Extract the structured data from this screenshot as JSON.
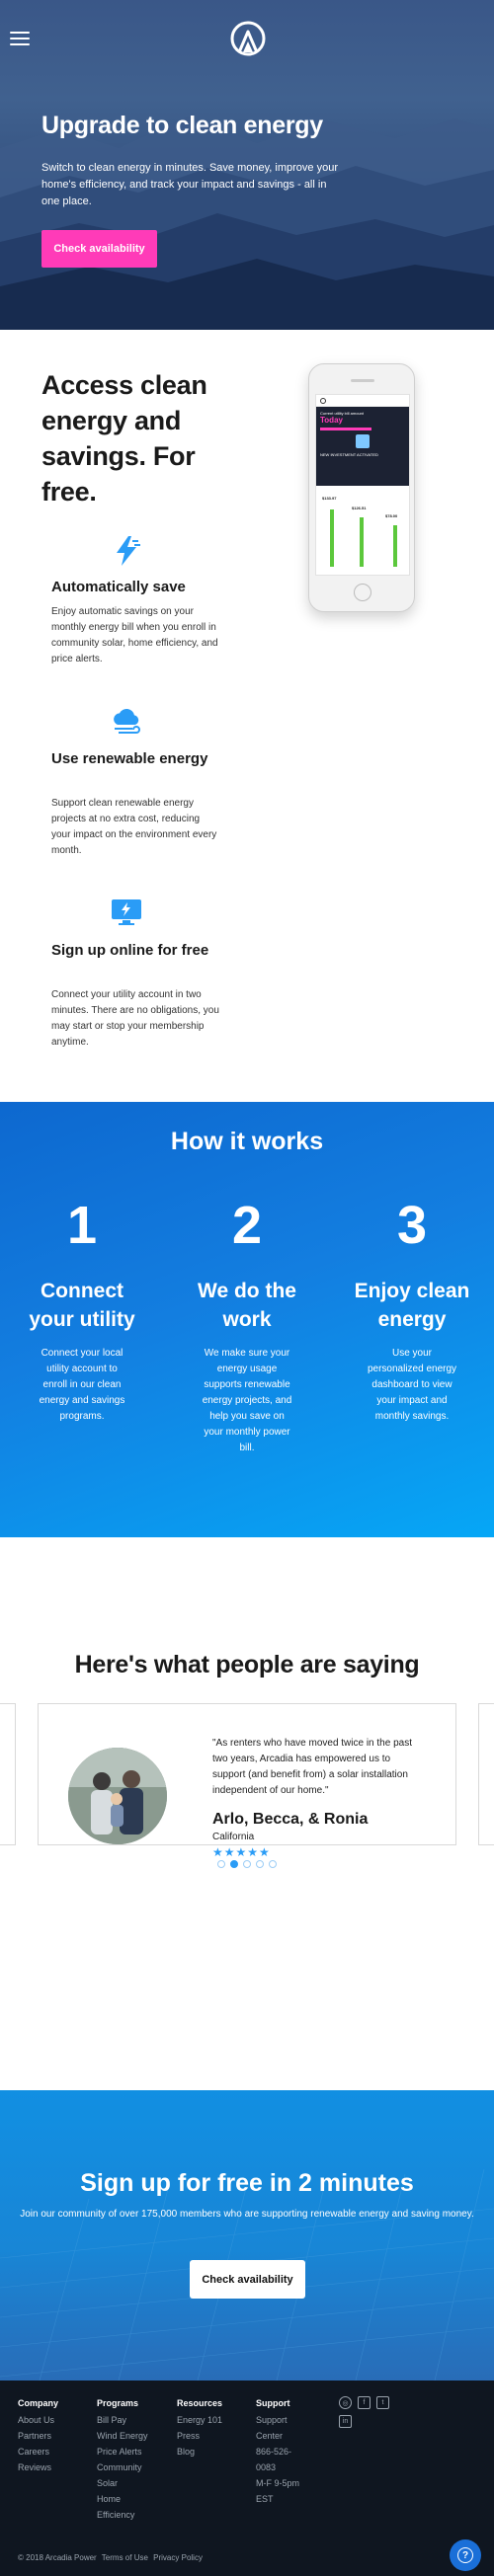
{
  "nav": {
    "menu_icon": "hamburger-menu-icon",
    "logo_icon": "arcadia-logo-icon"
  },
  "hero": {
    "title": "Upgrade to clean energy",
    "subtitle": "Switch to clean energy in minutes. Save money, improve your home's efficiency, and track your impact and savings - all in one place.",
    "cta_label": "Check availability"
  },
  "features": {
    "heading": "Access clean energy and savings. For free.",
    "items": [
      {
        "icon": "lightning-bolt-icon",
        "title": "Automatically save",
        "body": "Enjoy automatic savings on your monthly energy bill when you enroll in community solar, home efficiency, and price alerts."
      },
      {
        "icon": "cloud-wind-icon",
        "title": "Use renewable energy",
        "body": "Support clean renewable energy projects at no extra cost, reducing your impact on the environment every month."
      },
      {
        "icon": "monitor-bolt-icon",
        "title": "Sign up online for free",
        "body": "Connect your utility account in two minutes. There are no obligations, you may start or stop your membership anytime."
      }
    ],
    "phone": {
      "screen_line1": "Current utility bill amount",
      "screen_big": "Today",
      "screen_caption": "NEW INVESTMENT ACTIVATED",
      "values": [
        "$133.97",
        "$126.51",
        "$78.00"
      ],
      "green_color": "#5cc83c"
    }
  },
  "how": {
    "heading": "How it works",
    "steps": [
      {
        "num": "1",
        "title": "Connect your utility",
        "body": "Connect your local utility account to enroll in our clean energy and savings programs."
      },
      {
        "num": "2",
        "title": "We do the work",
        "body": "We make sure your energy usage supports renewable energy projects, and help you save on your monthly power bill."
      },
      {
        "num": "3",
        "title": "Enjoy clean energy",
        "body": "Use your personalized energy dashboard to view your impact and monthly savings."
      }
    ]
  },
  "testimonials": {
    "heading": "Here's what people are saying",
    "quote": "\"As renters who have moved twice in the past two years, Arcadia has empowered us to support (and benefit from) a solar installation independent of our home.\"",
    "author": "Arlo, Becca, & Ronia",
    "location": "California",
    "stars": "★★★★★",
    "rating": 5,
    "slide_count": 5,
    "active_slide": 2
  },
  "signup": {
    "heading": "Sign up for free in 2 minutes",
    "body": "Join our community of over 175,000 members who are supporting renewable energy and saving money.",
    "cta_label": "Check availability"
  },
  "footer": {
    "columns": [
      {
        "title": "Company",
        "links": [
          "About Us",
          "Partners",
          "Careers",
          "Reviews"
        ]
      },
      {
        "title": "Programs",
        "links": [
          "Bill Pay",
          "Wind Energy",
          "Price Alerts",
          "Community Solar",
          "Home Efficiency"
        ]
      },
      {
        "title": "Resources",
        "links": [
          "Energy 101",
          "Press",
          "Blog"
        ]
      },
      {
        "title": "Support",
        "links": [
          "Support Center",
          "866-526-0083",
          "M-F 9-5pm EST"
        ]
      }
    ],
    "social": [
      "instagram-icon",
      "facebook-icon",
      "twitter-icon",
      "linkedin-icon"
    ],
    "copyright": "© 2018 Arcadia Power",
    "terms": "Terms of Use",
    "privacy": "Privacy Policy",
    "help_icon": "help-question-icon"
  },
  "colors": {
    "accent_pink": "#ff3bb8",
    "brand_blue": "#137ee0",
    "star_blue": "#2a9cf6",
    "footer_bg": "#0f1620"
  }
}
